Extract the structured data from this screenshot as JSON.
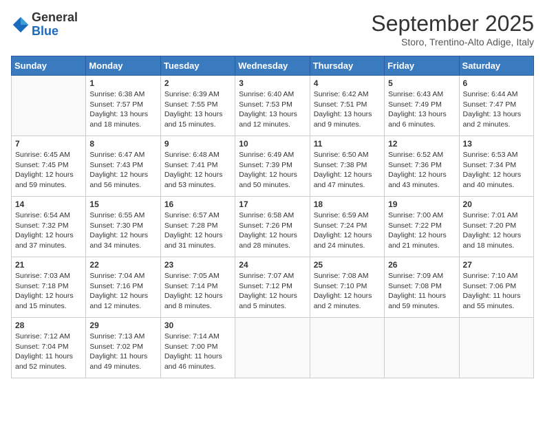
{
  "logo": {
    "general": "General",
    "blue": "Blue"
  },
  "header": {
    "month": "September 2025",
    "location": "Storo, Trentino-Alto Adige, Italy"
  },
  "weekdays": [
    "Sunday",
    "Monday",
    "Tuesday",
    "Wednesday",
    "Thursday",
    "Friday",
    "Saturday"
  ],
  "weeks": [
    [
      {
        "day": "",
        "sunrise": "",
        "sunset": "",
        "daylight": "",
        "empty": true
      },
      {
        "day": "1",
        "sunrise": "Sunrise: 6:38 AM",
        "sunset": "Sunset: 7:57 PM",
        "daylight": "Daylight: 13 hours and 18 minutes."
      },
      {
        "day": "2",
        "sunrise": "Sunrise: 6:39 AM",
        "sunset": "Sunset: 7:55 PM",
        "daylight": "Daylight: 13 hours and 15 minutes."
      },
      {
        "day": "3",
        "sunrise": "Sunrise: 6:40 AM",
        "sunset": "Sunset: 7:53 PM",
        "daylight": "Daylight: 13 hours and 12 minutes."
      },
      {
        "day": "4",
        "sunrise": "Sunrise: 6:42 AM",
        "sunset": "Sunset: 7:51 PM",
        "daylight": "Daylight: 13 hours and 9 minutes."
      },
      {
        "day": "5",
        "sunrise": "Sunrise: 6:43 AM",
        "sunset": "Sunset: 7:49 PM",
        "daylight": "Daylight: 13 hours and 6 minutes."
      },
      {
        "day": "6",
        "sunrise": "Sunrise: 6:44 AM",
        "sunset": "Sunset: 7:47 PM",
        "daylight": "Daylight: 13 hours and 2 minutes."
      }
    ],
    [
      {
        "day": "7",
        "sunrise": "Sunrise: 6:45 AM",
        "sunset": "Sunset: 7:45 PM",
        "daylight": "Daylight: 12 hours and 59 minutes."
      },
      {
        "day": "8",
        "sunrise": "Sunrise: 6:47 AM",
        "sunset": "Sunset: 7:43 PM",
        "daylight": "Daylight: 12 hours and 56 minutes."
      },
      {
        "day": "9",
        "sunrise": "Sunrise: 6:48 AM",
        "sunset": "Sunset: 7:41 PM",
        "daylight": "Daylight: 12 hours and 53 minutes."
      },
      {
        "day": "10",
        "sunrise": "Sunrise: 6:49 AM",
        "sunset": "Sunset: 7:39 PM",
        "daylight": "Daylight: 12 hours and 50 minutes."
      },
      {
        "day": "11",
        "sunrise": "Sunrise: 6:50 AM",
        "sunset": "Sunset: 7:38 PM",
        "daylight": "Daylight: 12 hours and 47 minutes."
      },
      {
        "day": "12",
        "sunrise": "Sunrise: 6:52 AM",
        "sunset": "Sunset: 7:36 PM",
        "daylight": "Daylight: 12 hours and 43 minutes."
      },
      {
        "day": "13",
        "sunrise": "Sunrise: 6:53 AM",
        "sunset": "Sunset: 7:34 PM",
        "daylight": "Daylight: 12 hours and 40 minutes."
      }
    ],
    [
      {
        "day": "14",
        "sunrise": "Sunrise: 6:54 AM",
        "sunset": "Sunset: 7:32 PM",
        "daylight": "Daylight: 12 hours and 37 minutes."
      },
      {
        "day": "15",
        "sunrise": "Sunrise: 6:55 AM",
        "sunset": "Sunset: 7:30 PM",
        "daylight": "Daylight: 12 hours and 34 minutes."
      },
      {
        "day": "16",
        "sunrise": "Sunrise: 6:57 AM",
        "sunset": "Sunset: 7:28 PM",
        "daylight": "Daylight: 12 hours and 31 minutes."
      },
      {
        "day": "17",
        "sunrise": "Sunrise: 6:58 AM",
        "sunset": "Sunset: 7:26 PM",
        "daylight": "Daylight: 12 hours and 28 minutes."
      },
      {
        "day": "18",
        "sunrise": "Sunrise: 6:59 AM",
        "sunset": "Sunset: 7:24 PM",
        "daylight": "Daylight: 12 hours and 24 minutes."
      },
      {
        "day": "19",
        "sunrise": "Sunrise: 7:00 AM",
        "sunset": "Sunset: 7:22 PM",
        "daylight": "Daylight: 12 hours and 21 minutes."
      },
      {
        "day": "20",
        "sunrise": "Sunrise: 7:01 AM",
        "sunset": "Sunset: 7:20 PM",
        "daylight": "Daylight: 12 hours and 18 minutes."
      }
    ],
    [
      {
        "day": "21",
        "sunrise": "Sunrise: 7:03 AM",
        "sunset": "Sunset: 7:18 PM",
        "daylight": "Daylight: 12 hours and 15 minutes."
      },
      {
        "day": "22",
        "sunrise": "Sunrise: 7:04 AM",
        "sunset": "Sunset: 7:16 PM",
        "daylight": "Daylight: 12 hours and 12 minutes."
      },
      {
        "day": "23",
        "sunrise": "Sunrise: 7:05 AM",
        "sunset": "Sunset: 7:14 PM",
        "daylight": "Daylight: 12 hours and 8 minutes."
      },
      {
        "day": "24",
        "sunrise": "Sunrise: 7:07 AM",
        "sunset": "Sunset: 7:12 PM",
        "daylight": "Daylight: 12 hours and 5 minutes."
      },
      {
        "day": "25",
        "sunrise": "Sunrise: 7:08 AM",
        "sunset": "Sunset: 7:10 PM",
        "daylight": "Daylight: 12 hours and 2 minutes."
      },
      {
        "day": "26",
        "sunrise": "Sunrise: 7:09 AM",
        "sunset": "Sunset: 7:08 PM",
        "daylight": "Daylight: 11 hours and 59 minutes."
      },
      {
        "day": "27",
        "sunrise": "Sunrise: 7:10 AM",
        "sunset": "Sunset: 7:06 PM",
        "daylight": "Daylight: 11 hours and 55 minutes."
      }
    ],
    [
      {
        "day": "28",
        "sunrise": "Sunrise: 7:12 AM",
        "sunset": "Sunset: 7:04 PM",
        "daylight": "Daylight: 11 hours and 52 minutes."
      },
      {
        "day": "29",
        "sunrise": "Sunrise: 7:13 AM",
        "sunset": "Sunset: 7:02 PM",
        "daylight": "Daylight: 11 hours and 49 minutes."
      },
      {
        "day": "30",
        "sunrise": "Sunrise: 7:14 AM",
        "sunset": "Sunset: 7:00 PM",
        "daylight": "Daylight: 11 hours and 46 minutes."
      },
      {
        "day": "",
        "sunrise": "",
        "sunset": "",
        "daylight": "",
        "empty": true
      },
      {
        "day": "",
        "sunrise": "",
        "sunset": "",
        "daylight": "",
        "empty": true
      },
      {
        "day": "",
        "sunrise": "",
        "sunset": "",
        "daylight": "",
        "empty": true
      },
      {
        "day": "",
        "sunrise": "",
        "sunset": "",
        "daylight": "",
        "empty": true
      }
    ]
  ]
}
